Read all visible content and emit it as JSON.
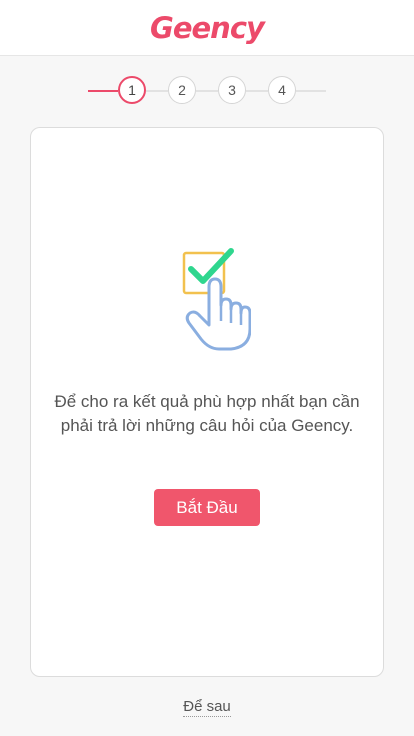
{
  "header": {
    "logo_text": "Geency"
  },
  "stepper": {
    "steps": [
      "1",
      "2",
      "3",
      "4"
    ],
    "active_step": 1,
    "accent_color": "#ec4a6a"
  },
  "card": {
    "illustration_icon": "checkbox-tap-icon",
    "message": "Để cho ra kết quả phù hợp nhất bạn cần phải trả lời những câu hỏi của Geency.",
    "start_button_label": "Bắt Đầu",
    "button_color": "#f0566c"
  },
  "footer": {
    "later_link": "Để sau"
  }
}
